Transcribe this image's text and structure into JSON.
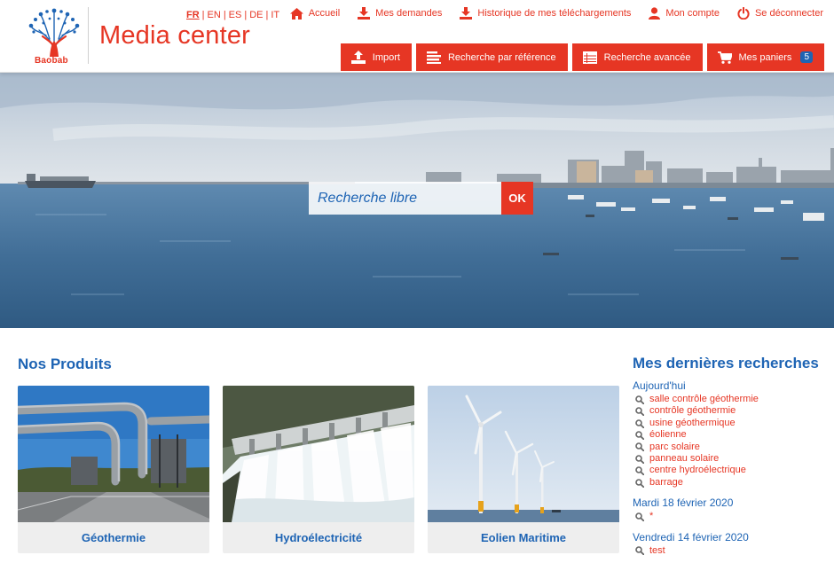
{
  "header": {
    "logo_text": "Baobab",
    "app_title": "Media center",
    "languages": [
      {
        "code": "FR",
        "active": true
      },
      {
        "code": "EN",
        "active": false
      },
      {
        "code": "ES",
        "active": false
      },
      {
        "code": "DE",
        "active": false
      },
      {
        "code": "IT",
        "active": false
      }
    ],
    "nav": [
      {
        "label": "Accueil",
        "icon": "home-icon"
      },
      {
        "label": "Mes demandes",
        "icon": "download-icon"
      },
      {
        "label": "Historique de mes téléchargements",
        "icon": "download-icon"
      },
      {
        "label": "Mon compte",
        "icon": "user-icon"
      },
      {
        "label": "Se déconnecter",
        "icon": "power-icon"
      }
    ],
    "actions": [
      {
        "label": "Import",
        "icon": "upload-icon"
      },
      {
        "label": "Recherche par référence",
        "icon": "list-icon"
      },
      {
        "label": "Recherche avancée",
        "icon": "table-icon"
      },
      {
        "label": "Mes paniers",
        "icon": "cart-icon",
        "badge": "5"
      }
    ]
  },
  "hero": {
    "search_placeholder": "Recherche libre",
    "search_button": "OK"
  },
  "products": {
    "title": "Nos Produits",
    "items": [
      {
        "label": "Géothermie"
      },
      {
        "label": "Hydroélectricité"
      },
      {
        "label": "Eolien Maritime"
      }
    ]
  },
  "recent": {
    "title": "Mes dernières recherches",
    "groups": [
      {
        "date": "Aujourd'hui",
        "items": [
          "salle contrôle géothermie",
          "contrôle géothermie",
          "usine géothermique",
          "éolienne",
          "parc solaire",
          "panneau solaire",
          "centre hydroélectrique",
          "barrage"
        ]
      },
      {
        "date": "Mardi 18 février 2020",
        "items": [
          "*"
        ]
      },
      {
        "date": "Vendredi 14 février 2020",
        "items": [
          "test"
        ]
      }
    ]
  },
  "colors": {
    "accent": "#e63624",
    "brand_blue": "#1e64b4",
    "card_bg": "#eeeeee"
  }
}
